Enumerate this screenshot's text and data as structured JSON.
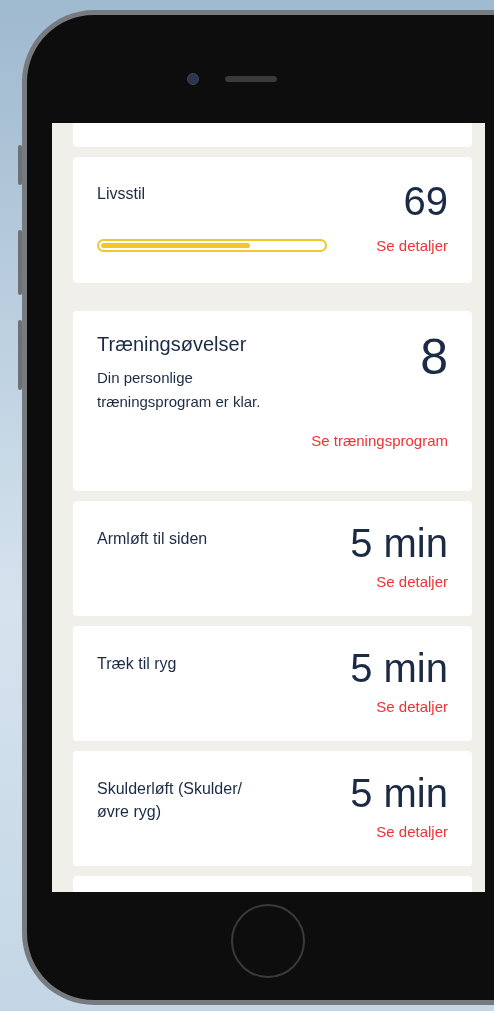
{
  "cards": [
    {
      "kind": "score",
      "title": "Livsstil",
      "value": "69",
      "level": 0.67,
      "link": "Se detaljer"
    },
    {
      "kind": "program",
      "title": "Træningsøvelser",
      "description": "Din personlige træningsprogram er klar.",
      "value": "8",
      "link": "Se træningsprogram"
    },
    {
      "kind": "exercise",
      "title": "Armløft til siden",
      "value": "5 min",
      "link": "Se detaljer"
    },
    {
      "kind": "exercise",
      "title": "Træk til ryg",
      "value": "5 min",
      "link": "Se detaljer"
    },
    {
      "kind": "exercise",
      "title": "Skulderløft (Skulder/øvre ryg)",
      "value": "5 min",
      "link": "Se detaljer"
    }
  ]
}
